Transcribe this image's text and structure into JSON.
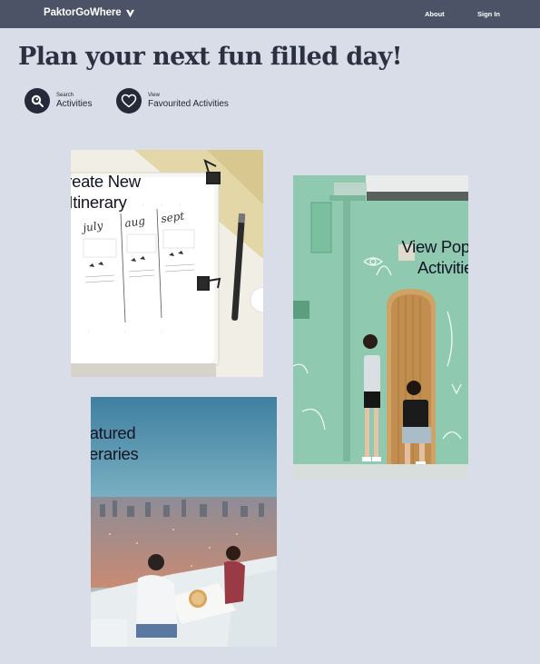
{
  "navbar": {
    "brand": "PaktorGoWhere",
    "links": [
      "About",
      "Sign In"
    ]
  },
  "page": {
    "title": "Plan your next fun filled day!"
  },
  "quick_actions": [
    {
      "small": "Search",
      "big": "Activities",
      "icon": "search-icon"
    },
    {
      "small": "View",
      "big": "Favourited Activities",
      "icon": "heart-icon"
    }
  ],
  "cards": {
    "create": {
      "line1": "Create New",
      "line2": "Itinerary"
    },
    "popular": {
      "line1": "View Popular",
      "line2": "Activities"
    },
    "featured": {
      "line1": "Featured",
      "line2": "Itineraries"
    }
  },
  "colors": {
    "navbar": "#4c5366",
    "background": "#d9dde8",
    "icon_circle": "#252a3a"
  }
}
